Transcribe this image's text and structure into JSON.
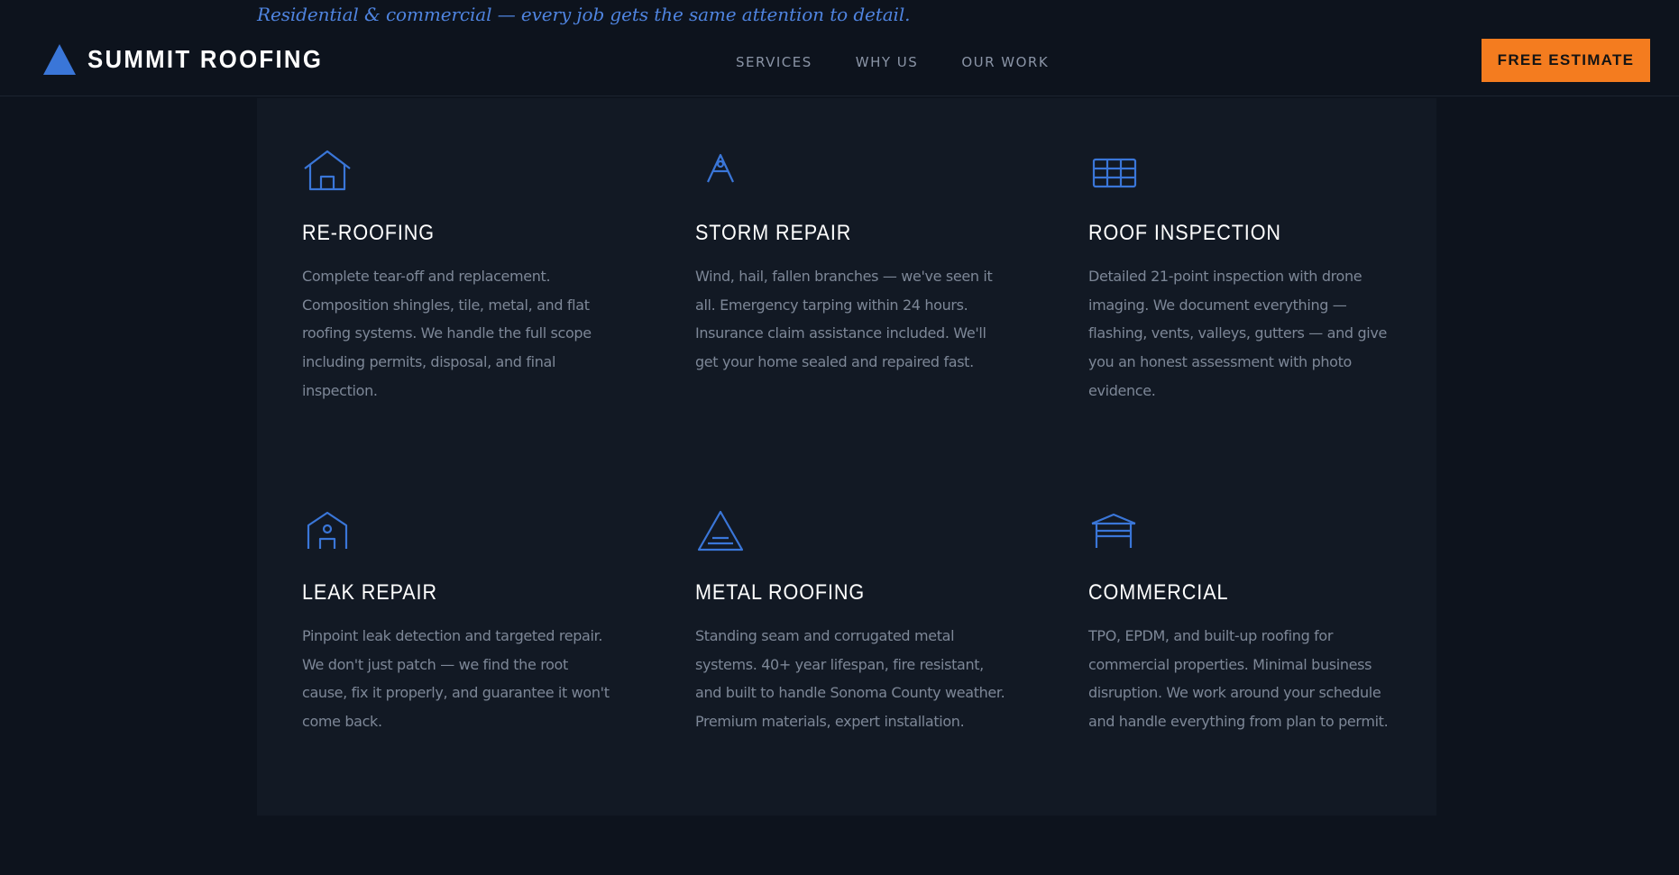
{
  "tagline": "Residential & commercial — every job gets the same attention to detail.",
  "header": {
    "brand": "SUMMIT ROOFING",
    "logo_icon": "triangle-peak-icon",
    "nav": [
      "SERVICES",
      "WHY US",
      "OUR WORK"
    ],
    "cta_label": "FREE ESTIMATE"
  },
  "services": [
    {
      "icon": "house-icon",
      "title": "RE-ROOFING",
      "description": "Complete tear-off and replacement. Composition shingles, tile, metal, and flat roofing systems. We handle the full scope including permits, disposal, and final inspection."
    },
    {
      "icon": "storm-peak-icon",
      "title": "STORM REPAIR",
      "description": "Wind, hail, fallen branches — we've seen it all. Emergency tarping within 24 hours. Insurance claim assistance included. We'll get your home sealed and repaired fast."
    },
    {
      "icon": "inspection-grid-icon",
      "title": "ROOF INSPECTION",
      "description": "Detailed 21-point inspection with drone imaging. We document everything — flashing, vents, valleys, gutters — and give you an honest assessment with photo evidence."
    },
    {
      "icon": "leak-house-icon",
      "title": "LEAK REPAIR",
      "description": "Pinpoint leak detection and targeted repair. We don't just patch — we find the root cause, fix it properly, and guarantee it won't come back."
    },
    {
      "icon": "metal-roof-icon",
      "title": "METAL ROOFING",
      "description": "Standing seam and corrugated metal systems. 40+ year lifespan, fire resistant, and built to handle Sonoma County weather. Premium materials, expert installation."
    },
    {
      "icon": "commercial-building-icon",
      "title": "COMMERCIAL",
      "description": "TPO, EPDM, and built-up roofing for commercial properties. Minimal business disruption. We work around your schedule and handle everything from plan to permit."
    }
  ],
  "colors": {
    "background": "#0d131d",
    "panel": "#121924",
    "accent_blue": "#3a76d8",
    "accent_orange": "#f47c1f",
    "text_muted": "#7d8797"
  }
}
